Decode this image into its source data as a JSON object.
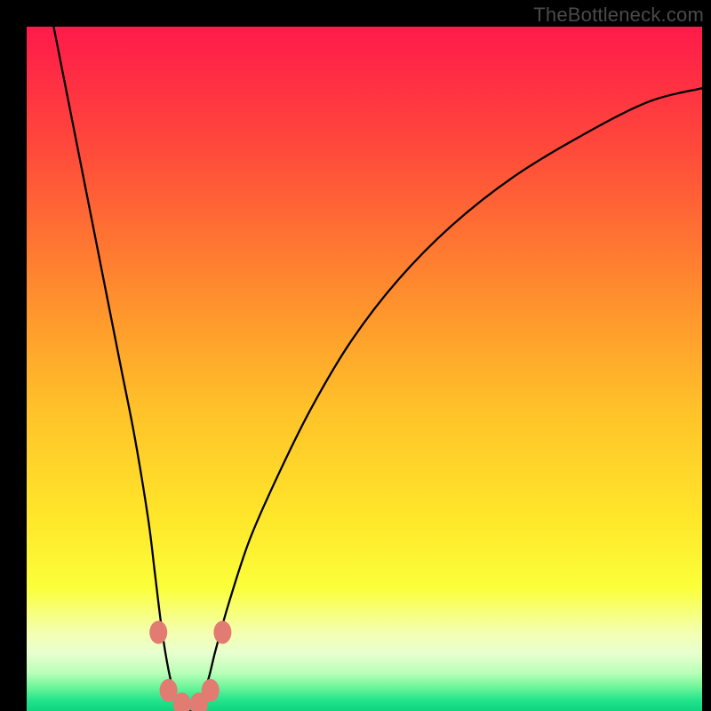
{
  "watermark": "TheBottleneck.com",
  "colors": {
    "frame": "#000000",
    "curve": "#000000",
    "marker": "#e27b72",
    "gradient_stops": [
      {
        "offset": 0.0,
        "color": "#ff1a4b"
      },
      {
        "offset": 0.18,
        "color": "#ff4a3a"
      },
      {
        "offset": 0.38,
        "color": "#ff8a2e"
      },
      {
        "offset": 0.56,
        "color": "#ffc229"
      },
      {
        "offset": 0.72,
        "color": "#ffe72a"
      },
      {
        "offset": 0.82,
        "color": "#fbff3a"
      },
      {
        "offset": 0.885,
        "color": "#f4ffb0"
      },
      {
        "offset": 0.915,
        "color": "#e8ffcf"
      },
      {
        "offset": 0.945,
        "color": "#b8ffb8"
      },
      {
        "offset": 0.965,
        "color": "#6ef59a"
      },
      {
        "offset": 0.985,
        "color": "#22e38b"
      },
      {
        "offset": 1.0,
        "color": "#0fd47e"
      }
    ]
  },
  "chart_data": {
    "type": "line",
    "title": "",
    "xlabel": "",
    "ylabel": "",
    "xlim": [
      0,
      100
    ],
    "ylim": [
      0,
      100
    ],
    "grid": false,
    "legend": false,
    "series": [
      {
        "name": "bottleneck-curve",
        "x": [
          4,
          6,
          8,
          10,
          12,
          14,
          16,
          18,
          19,
          20,
          21,
          22,
          23,
          24,
          25,
          26,
          27,
          28,
          30,
          33,
          37,
          42,
          48,
          55,
          63,
          72,
          82,
          92,
          100
        ],
        "y": [
          100,
          90,
          80,
          70,
          60,
          50,
          40,
          28,
          20,
          12,
          6,
          2,
          0,
          0,
          0,
          2,
          5,
          9,
          16,
          25,
          34,
          44,
          54,
          63,
          71,
          78,
          84,
          89,
          91
        ]
      }
    ],
    "markers": [
      {
        "x": 19.5,
        "y": 11.5
      },
      {
        "x": 21.0,
        "y": 3.0
      },
      {
        "x": 23.0,
        "y": 1.0
      },
      {
        "x": 25.5,
        "y": 1.0
      },
      {
        "x": 27.2,
        "y": 3.0
      },
      {
        "x": 29.0,
        "y": 11.5
      }
    ]
  }
}
